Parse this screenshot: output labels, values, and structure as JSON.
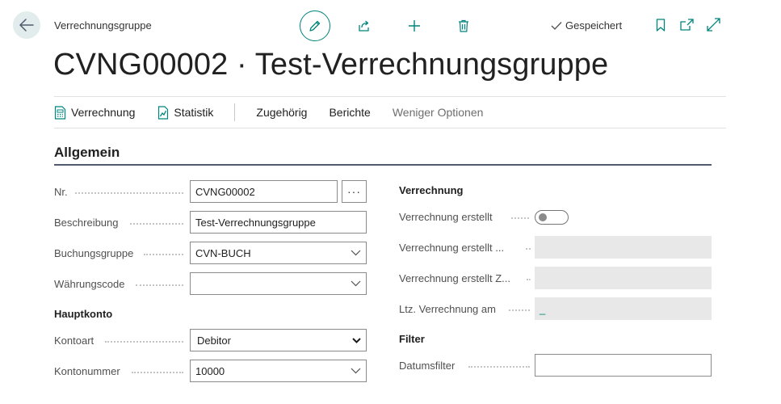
{
  "header": {
    "breadcrumb": "Verrechnungsgruppe",
    "saved_status": "Gespeichert",
    "title": "CVNG00002 · Test-Verrechnungsgruppe"
  },
  "actions": [
    {
      "label": "Verrechnung"
    },
    {
      "label": "Statistik"
    },
    {
      "label": "Zugehörig"
    },
    {
      "label": "Berichte"
    },
    {
      "label": "Weniger Optionen"
    }
  ],
  "section": {
    "title": "Allgemein"
  },
  "fields_left": {
    "nr": {
      "label": "Nr.",
      "value": "CVNG00002",
      "ellipsis": "···"
    },
    "beschreibung": {
      "label": "Beschreibung",
      "value": "Test-Verrechnungsgruppe"
    },
    "buchungsgruppe": {
      "label": "Buchungsgruppe",
      "value": "CVN-BUCH"
    },
    "waehrungscode": {
      "label": "Währungscode",
      "value": ""
    },
    "hauptkonto_heading": "Hauptkonto",
    "kontoart": {
      "label": "Kontoart",
      "value": "Debitor"
    },
    "kontonummer": {
      "label": "Kontonummer",
      "value": "10000"
    }
  },
  "fields_right": {
    "verrechnung_heading": "Verrechnung",
    "erstellt": {
      "label": "Verrechnung erstellt",
      "checked": false
    },
    "erstellt_am": {
      "label": "Verrechnung erstellt ...",
      "value": ""
    },
    "erstellt_zeit": {
      "label": "Verrechnung erstellt Z...",
      "value": ""
    },
    "ltz": {
      "label": "Ltz. Verrechnung am",
      "value": "_"
    },
    "filter_heading": "Filter",
    "datumsfilter": {
      "label": "Datumsfilter",
      "value": ""
    }
  },
  "colors": {
    "accent": "#00847c",
    "readonly_bg": "#e8e8e8",
    "section_line": "#505c6d"
  }
}
